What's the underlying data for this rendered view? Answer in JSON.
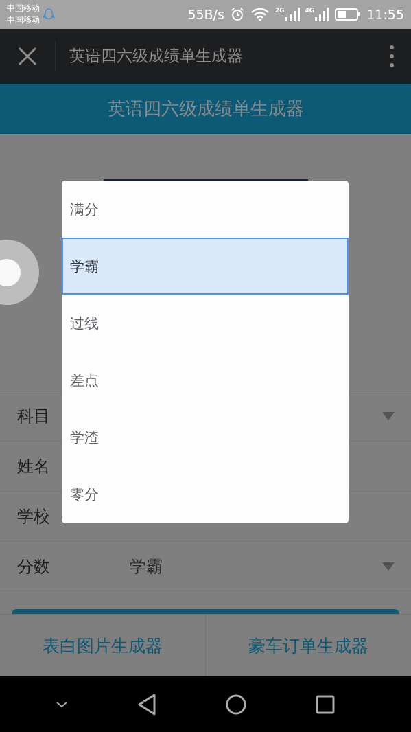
{
  "status_bar": {
    "carriers": [
      "中国移动",
      "中国移动"
    ],
    "speed": "55B/s",
    "signals": [
      "2G",
      "4G"
    ],
    "time": "11:55"
  },
  "browser_bar": {
    "title": "英语四六级成绩单生成器"
  },
  "header": {
    "title": "英语四六级成绩单生成器"
  },
  "form": {
    "rows": [
      {
        "kind": "select",
        "label": "科目"
      },
      {
        "kind": "text",
        "label": "姓名"
      },
      {
        "kind": "text",
        "label": "学校"
      },
      {
        "kind": "select",
        "label": "分数",
        "value": "学霸"
      }
    ]
  },
  "dialog": {
    "options": [
      {
        "label": "满分",
        "selected": false
      },
      {
        "label": "学霸",
        "selected": true
      },
      {
        "label": "过线",
        "selected": false
      },
      {
        "label": "差点",
        "selected": false
      },
      {
        "label": "学渣",
        "selected": false
      },
      {
        "label": "零分",
        "selected": false
      }
    ]
  },
  "footer_links": [
    "表白图片生成器",
    "豪车订单生成器"
  ]
}
